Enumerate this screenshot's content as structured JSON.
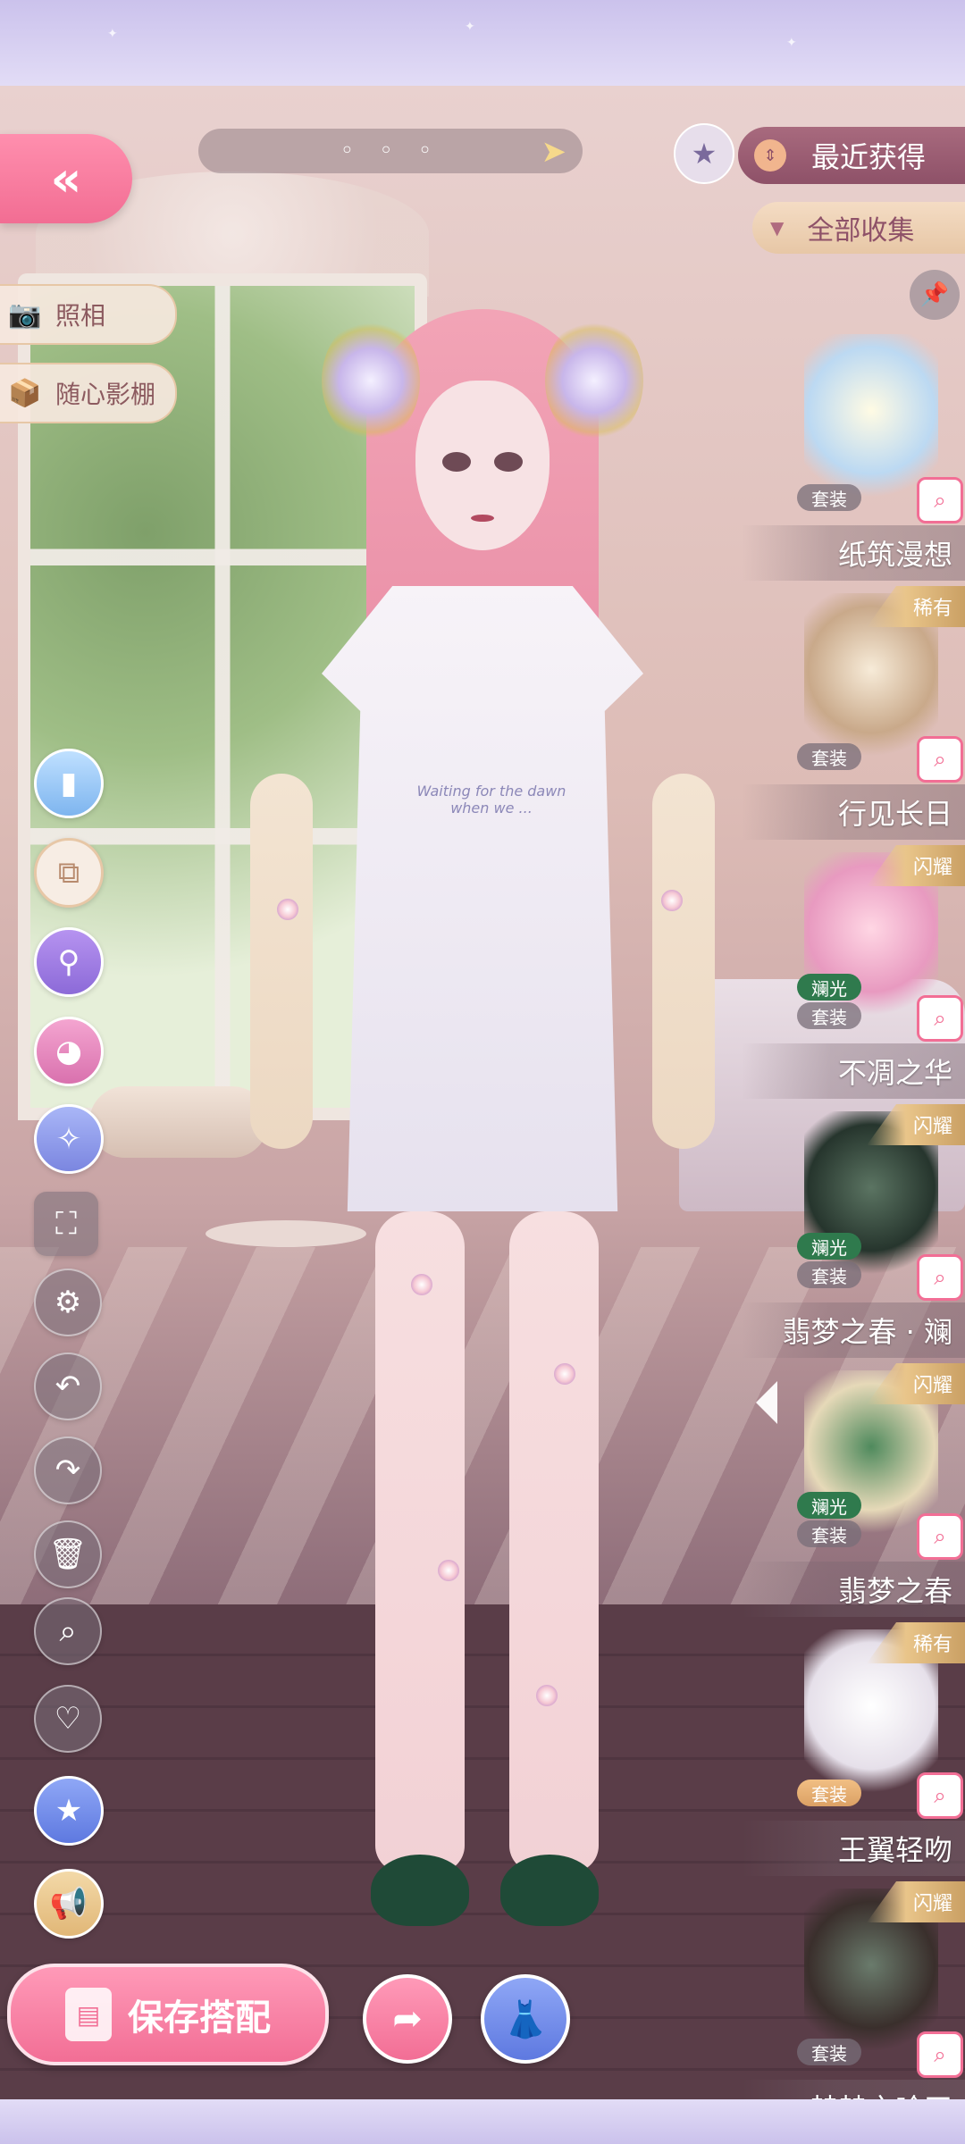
{
  "top_bar": {
    "dots": "◦ ◦ ◦",
    "arrow_icon": "arrow-right-icon"
  },
  "sort": {
    "label": "最近获得"
  },
  "filter": {
    "label": "全部收集"
  },
  "side_buttons": [
    {
      "label": "照相",
      "icon": "camera-icon"
    },
    {
      "label": "随心影棚",
      "icon": "studio-box-icon"
    }
  ],
  "tools": [
    "cup-icon",
    "layers-icon",
    "magnify-adjust-icon",
    "palette-icon",
    "sparkle-star-icon",
    "fullscreen-icon",
    "settings-icon",
    "undo-icon",
    "redo-icon",
    "trash-icon",
    "search-icon",
    "heart-icon",
    "star-icon",
    "megaphone-icon"
  ],
  "save_button": {
    "label": "保存搭配"
  },
  "dress_text": "Waiting for the dawn when we ...",
  "items": [
    {
      "name": "纸筑漫想",
      "tag": "套装",
      "rarity": "",
      "glow": "",
      "tag_style": "gray",
      "colors": [
        "#fffbe4",
        "#bcd9f2"
      ]
    },
    {
      "name": "行见长日",
      "tag": "套装",
      "rarity": "稀有",
      "glow": "",
      "tag_style": "gray",
      "colors": [
        "#f7ebd8",
        "#c9a98a"
      ]
    },
    {
      "name": "不凋之华",
      "tag": "套装",
      "rarity": "闪耀",
      "glow": "斓光",
      "tag_style": "gray",
      "colors": [
        "#ffd6e4",
        "#e89ac0"
      ]
    },
    {
      "name": "翡梦之春 · 斓",
      "tag": "套装",
      "rarity": "闪耀",
      "glow": "斓光",
      "tag_style": "gray",
      "colors": [
        "#5b7462",
        "#26352d"
      ]
    },
    {
      "name": "翡梦之春",
      "tag": "套装",
      "rarity": "闪耀",
      "glow": "斓光",
      "tag_style": "gray",
      "colors": [
        "#4f8a5d",
        "#e6d9b8"
      ]
    },
    {
      "name": "王翼轻吻",
      "tag": "套装",
      "rarity": "稀有",
      "glow": "",
      "tag_style": "gold",
      "colors": [
        "#ffffff",
        "#e6e0ea"
      ]
    },
    {
      "name": "赫赫之吟天",
      "tag": "套装",
      "rarity": "闪耀",
      "glow": "",
      "tag_style": "gray",
      "colors": [
        "#6a7b6c",
        "#3a2f2c"
      ]
    }
  ]
}
